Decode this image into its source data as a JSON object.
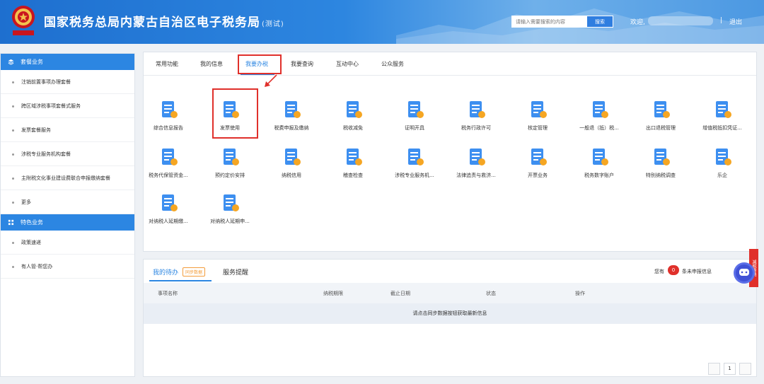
{
  "header": {
    "title": "国家税务总局内蒙古自治区电子税务局",
    "title_suffix": "(测试)",
    "emblem_caption": "中国税务",
    "search_placeholder": "请输入需要搜索的内容",
    "search_button": "搜索",
    "welcome": "欢迎,",
    "separator": "|",
    "logout": "退出",
    "brand_color": "#2c86e2"
  },
  "sidebar": {
    "section1": "套餐业务",
    "items1": [
      "注销前置事项办理套餐",
      "跨区域涉税事项套餐式服务",
      "发票套餐服务",
      "涉税专业服务机构套餐",
      "主附税文化事业建设费联合申报缴纳套餐",
      "更多"
    ],
    "section2": "特色业务",
    "items2": [
      "政策速递",
      "有人管·帮您办"
    ]
  },
  "tabs": [
    "常用功能",
    "我的信息",
    "我要办税",
    "我要查询",
    "互动中心",
    "公众服务"
  ],
  "active_tab": "我要办税",
  "services": [
    {
      "label": "综合信息报告",
      "icon": "report-icon"
    },
    {
      "label": "发票使用",
      "icon": "invoice-icon"
    },
    {
      "label": "税费申报及缴纳",
      "icon": "tax-payment-icon"
    },
    {
      "label": "税收减免",
      "icon": "tax-reduction-icon"
    },
    {
      "label": "证明开具",
      "icon": "certificate-icon"
    },
    {
      "label": "税务行政许可",
      "icon": "license-icon"
    },
    {
      "label": "核定管理",
      "icon": "verify-icon"
    },
    {
      "label": "一般退（抵）税...",
      "icon": "refund-icon"
    },
    {
      "label": "出口退税管理",
      "icon": "export-refund-icon"
    },
    {
      "label": "增值税抵扣凭证...",
      "icon": "vat-voucher-icon"
    },
    {
      "label": "税务代保管资金...",
      "icon": "custody-fund-icon"
    },
    {
      "label": "预约定价安排",
      "icon": "pricing-icon"
    },
    {
      "label": "纳税信用",
      "icon": "credit-icon"
    },
    {
      "label": "稽查检查",
      "icon": "inspection-icon"
    },
    {
      "label": "涉税专业服务机...",
      "icon": "agency-icon"
    },
    {
      "label": "法律追责与救济...",
      "icon": "legal-icon"
    },
    {
      "label": "开票业务",
      "icon": "billing-icon"
    },
    {
      "label": "税务数字账户",
      "icon": "digital-account-icon"
    },
    {
      "label": "特别纳税调查",
      "icon": "special-investigation-icon"
    },
    {
      "label": "乐企",
      "icon": "leqi-icon"
    },
    {
      "label": "对纳税人延期缴...",
      "icon": "deferred-payment-icon"
    },
    {
      "label": "对纳税人延期申...",
      "icon": "deferred-filing-icon"
    }
  ],
  "todo": {
    "tab1": "我的待办",
    "badge": "同步数据",
    "tab2": "服务提醒",
    "notice_pre": "您有",
    "notice_count": "0",
    "notice_post": "条未申报信息",
    "columns": [
      "事项名称",
      "纳税期限",
      "截止日期",
      "状态",
      "操作"
    ],
    "empty_text": "请点击同步数据按钮获取最新信息",
    "page": "1"
  },
  "float_tag": "减税降费"
}
